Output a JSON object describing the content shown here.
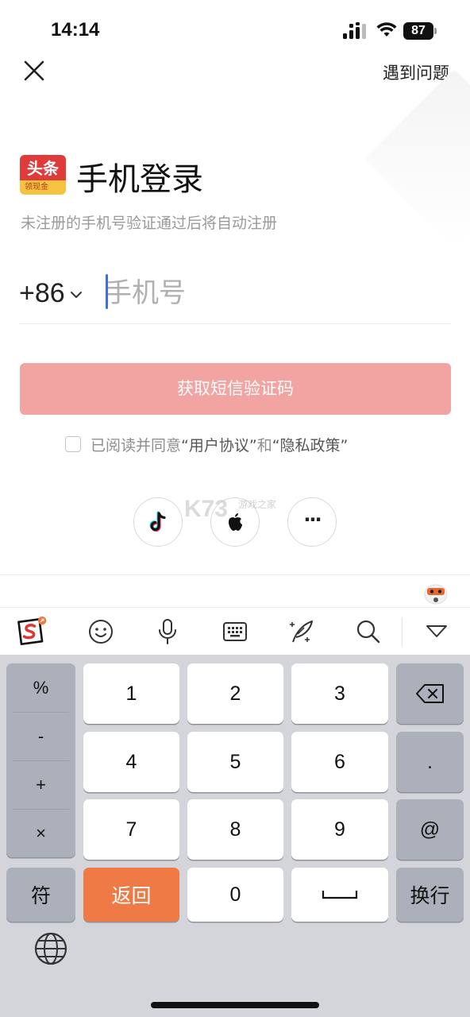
{
  "status_bar": {
    "time": "14:14",
    "battery": "87"
  },
  "header": {
    "help_label": "遇到问题"
  },
  "login": {
    "logo_main": "头条",
    "logo_sub": "领现金",
    "title": "手机登录",
    "subtitle": "未注册的手机号验证通过后将自动注册",
    "country_code": "+86",
    "phone_placeholder": "手机号",
    "phone_value": "",
    "sms_button_label": "获取短信验证码",
    "agreement": {
      "prefix": "已阅读并同意",
      "user_agreement": "“用户协议”",
      "and": "和",
      "privacy_policy": "“隐私政策”"
    },
    "social_more_label": "···",
    "watermark": "K73",
    "watermark_sub": "游戏之家"
  },
  "keyboard": {
    "symbols": [
      "%",
      "-",
      "+",
      "×"
    ],
    "digits": [
      "1",
      "2",
      "3",
      "4",
      "5",
      "6",
      "7",
      "8",
      "9"
    ],
    "dot": ".",
    "at": "@",
    "symbol_toggle": "符",
    "back": "返回",
    "zero": "0",
    "space": "␣",
    "enter": "换行"
  },
  "colors": {
    "accent_button": "#f1a4a2",
    "keyboard_accent": "#ef7a45",
    "caret": "#3a6ee8"
  }
}
